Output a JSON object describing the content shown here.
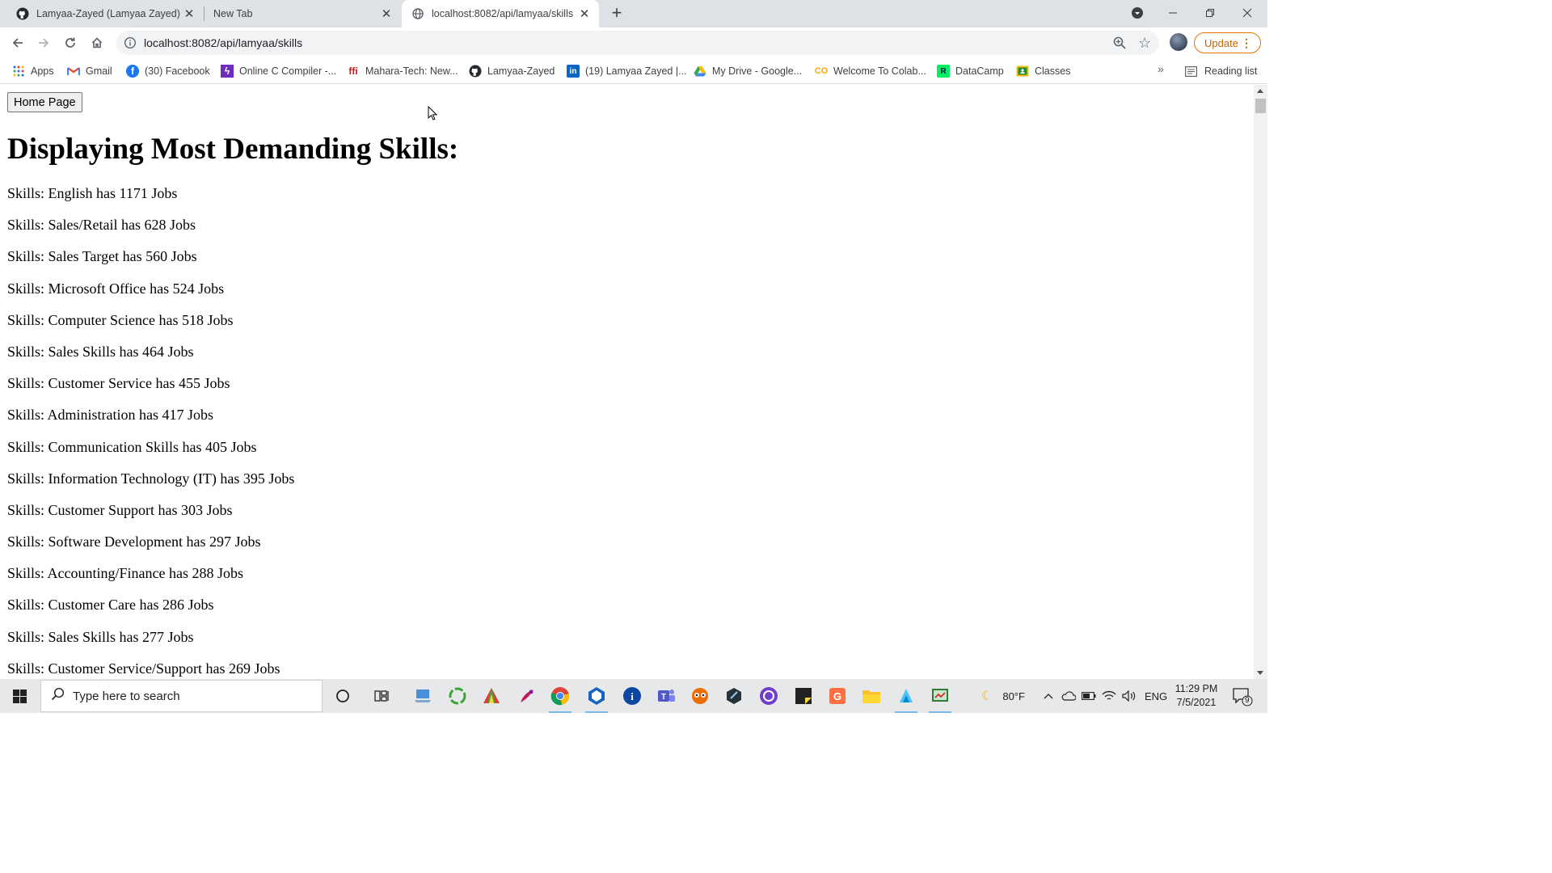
{
  "browser": {
    "tabs": [
      {
        "title": "Lamyaa-Zayed (Lamyaa Zayed)",
        "icon": "github-icon",
        "active": false
      },
      {
        "title": "New Tab",
        "icon": "",
        "active": false
      },
      {
        "title": "localhost:8082/api/lamyaa/skills",
        "icon": "globe-icon",
        "active": true
      }
    ],
    "address": "localhost:8082/api/lamyaa/skills",
    "update_label": "Update",
    "bookmarks": [
      {
        "label": "Apps",
        "icon": "apps-grid-icon"
      },
      {
        "label": "Gmail",
        "icon": "gmail-icon"
      },
      {
        "label": "(30) Facebook",
        "icon": "facebook-icon"
      },
      {
        "label": "Online C Compiler -...",
        "icon": "compiler-icon"
      },
      {
        "label": "Mahara-Tech: New...",
        "icon": "mahara-icon"
      },
      {
        "label": "Lamyaa-Zayed",
        "icon": "github-icon"
      },
      {
        "label": "(19) Lamyaa Zayed |...",
        "icon": "linkedin-icon"
      },
      {
        "label": "My Drive - Google...",
        "icon": "drive-icon"
      },
      {
        "label": "Welcome To Colab...",
        "icon": "colab-icon"
      },
      {
        "label": "DataCamp",
        "icon": "datacamp-icon"
      },
      {
        "label": "Classes",
        "icon": "classroom-icon"
      }
    ],
    "overflow_label": "»",
    "reading_list_label": "Reading list"
  },
  "page": {
    "home_button": "Home Page",
    "heading": "Displaying Most Demanding Skills:",
    "skills": [
      "Skills: English has 1171 Jobs",
      "Skills: Sales/Retail has 628 Jobs",
      "Skills: Sales Target has 560 Jobs",
      "Skills: Microsoft Office has 524 Jobs",
      "Skills: Computer Science has 518 Jobs",
      "Skills: Sales Skills has 464 Jobs",
      "Skills: Customer Service has 455 Jobs",
      "Skills: Administration has 417 Jobs",
      "Skills: Communication Skills has 405 Jobs",
      "Skills: Information Technology (IT) has 395 Jobs",
      "Skills: Customer Support has 303 Jobs",
      "Skills: Software Development has 297 Jobs",
      "Skills: Accounting/Finance has 288 Jobs",
      "Skills: Customer Care has 286 Jobs",
      "Skills: Sales Skills has 277 Jobs",
      "Skills: Customer Service/Support has 269 Jobs"
    ]
  },
  "taskbar": {
    "search_placeholder": "Type here to search",
    "weather": "80°F",
    "language": "ENG",
    "time": "11:29 PM",
    "date": "7/5/2021",
    "notification_count": "9"
  },
  "colors": {
    "tabstrip": "#dee1e6",
    "update_accent": "#e37400",
    "taskbar": "#e6e8ea"
  }
}
